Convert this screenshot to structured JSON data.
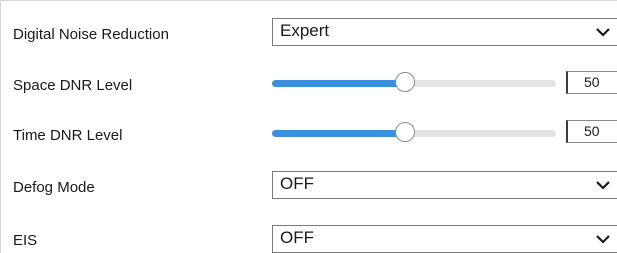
{
  "settings": {
    "dnr": {
      "label": "Digital Noise Reduction",
      "value": "Expert"
    },
    "space_dnr": {
      "label": "Space DNR Level",
      "value": "50",
      "level_fraction": 0.47
    },
    "time_dnr": {
      "label": "Time DNR Level",
      "value": "50",
      "level_fraction": 0.47
    },
    "defog": {
      "label": "Defog Mode",
      "value": "OFF"
    },
    "eis": {
      "label": "EIS",
      "value": "OFF"
    }
  },
  "icons": {
    "dropdown": "chevron-down-icon"
  },
  "colors": {
    "slider_fill": "#3a8fde",
    "slider_track": "#e3e3e3"
  }
}
